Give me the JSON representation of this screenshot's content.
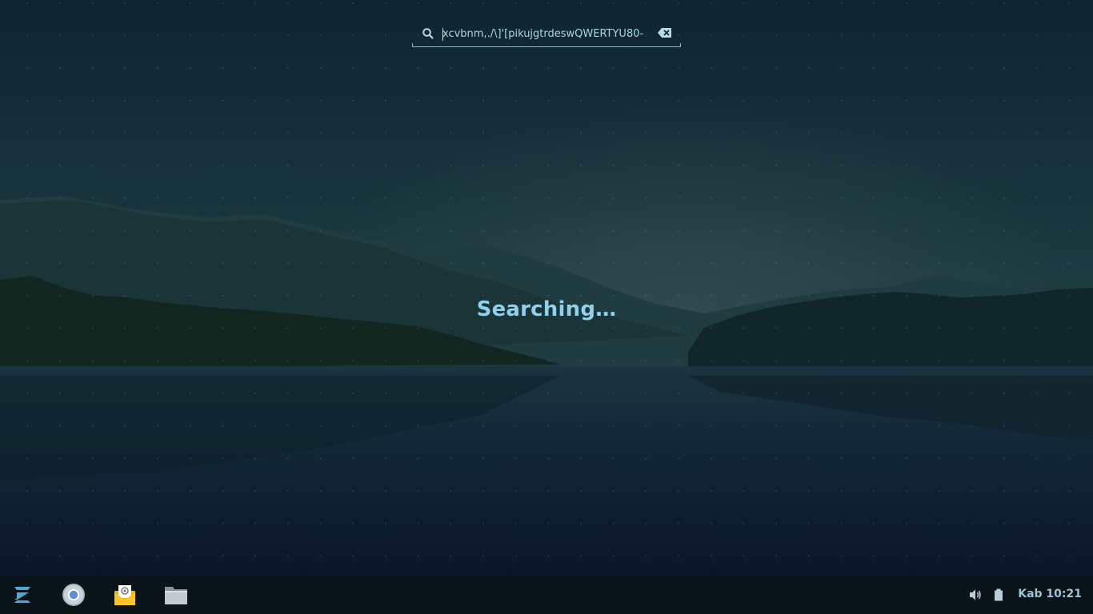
{
  "search": {
    "value": "xcvbnm,./\\]'[pikujgtrdeswQWERTYU80-",
    "icon": "search-icon",
    "clear_icon": "backspace-clear-icon"
  },
  "status": {
    "text": "Searching…"
  },
  "taskbar": {
    "launcher_icon": "zorin-menu-icon",
    "apps": [
      {
        "name": "browser",
        "icon": "chromium-icon"
      },
      {
        "name": "mail",
        "icon": "mail-icon"
      },
      {
        "name": "files",
        "icon": "folder-icon"
      }
    ],
    "tray": {
      "volume_icon": "volume-icon",
      "battery_icon": "battery-icon"
    },
    "clock": "Kab 10:21"
  },
  "colors": {
    "accent": "#8fd0ea",
    "taskbar_bg": "#0a1418"
  }
}
